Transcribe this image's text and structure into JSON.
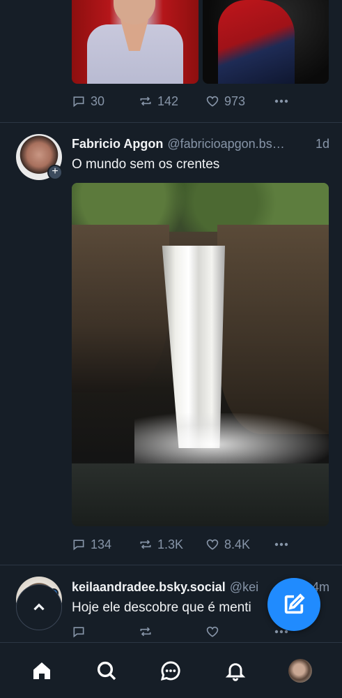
{
  "top_post": {
    "reply_count": "30",
    "repost_count": "142",
    "like_count": "973"
  },
  "post_fabricio": {
    "display_name": "Fabricio Apgon",
    "handle": "@fabricioapgon.bs…",
    "time": "1d",
    "text": "O mundo sem os crentes",
    "follow_badge": "+",
    "reply_count": "134",
    "repost_count": "1.3K",
    "like_count": "8.4K"
  },
  "post_keila": {
    "display_name": "keilaandradee.bsky.social",
    "handle": "@kei",
    "time": "4m",
    "text": "Hoje ele descobre que é menti"
  },
  "colors": {
    "background": "#161e27",
    "accent": "#208bfe",
    "muted": "#8795a8",
    "divider": "#2c3644"
  },
  "tabbar": {
    "items": [
      "home-icon",
      "search-icon",
      "chat-icon",
      "notifications-icon",
      "profile-avatar"
    ],
    "active": "home-icon"
  }
}
